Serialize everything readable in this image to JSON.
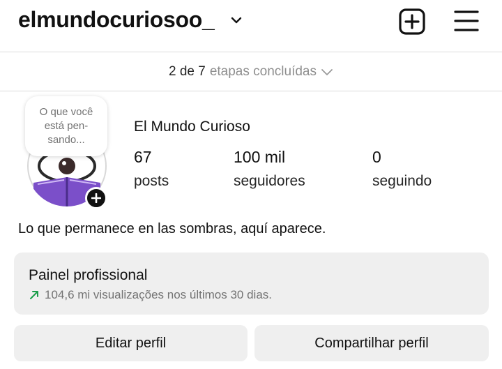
{
  "header": {
    "username": "elmundocuriosoo_"
  },
  "steps": {
    "done": "2 de 7",
    "label": "etapas concluídas"
  },
  "note": {
    "lines": [
      "O que você",
      "está pen-",
      "sando..."
    ]
  },
  "profile": {
    "full_name": "El Mundo Curioso",
    "stats": [
      {
        "value": "67",
        "label": "posts"
      },
      {
        "value": "100 mil",
        "label": "seguidores"
      },
      {
        "value": "0",
        "label": "seguindo"
      }
    ],
    "bio": "Lo que permanece en las sombras, aquí aparece."
  },
  "professional": {
    "title": "Painel profissional",
    "subtitle": "104,6 mi visualizações nos últimos 30 dias."
  },
  "buttons": {
    "edit": "Editar perfil",
    "share": "Compartilhar perfil"
  },
  "colors": {
    "trend_arrow": "#1a9e4a",
    "avatar_purple": "#7b4fc9",
    "button_bg": "#efefef"
  },
  "icons": {
    "username_dropdown": "chevron-down-icon",
    "new_post": "plus-square-icon",
    "menu": "hamburger-menu-icon",
    "steps_dropdown": "chevron-down-icon",
    "add_story": "plus-icon",
    "trend": "arrow-up-right-icon"
  }
}
